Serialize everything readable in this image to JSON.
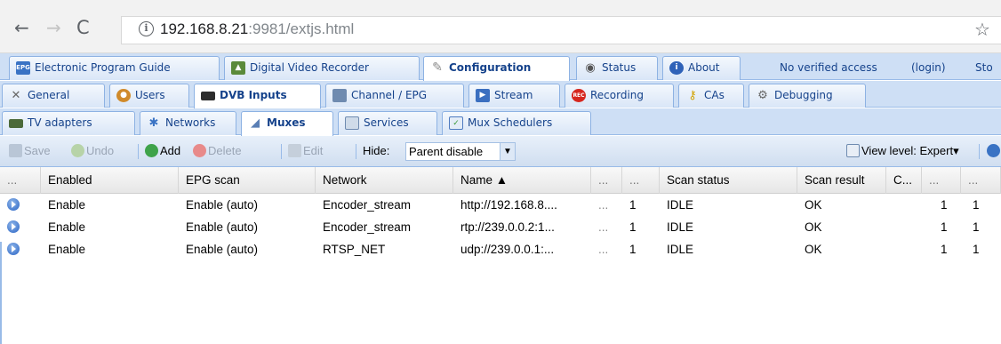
{
  "browser": {
    "url_host": "192.168.8.21",
    "url_rest": ":9981/extjs.html",
    "back": "←",
    "forward": "→",
    "reload": "C",
    "info": "i",
    "star": "☆"
  },
  "top_tabs": {
    "items": [
      {
        "label": "Electronic Program Guide",
        "icon": "epg-icon"
      },
      {
        "label": "Digital Video Recorder",
        "icon": "dvr-icon"
      },
      {
        "label": "Configuration",
        "icon": "wrench-icon",
        "active": true
      },
      {
        "label": "Status",
        "icon": "eye-icon"
      },
      {
        "label": "About",
        "icon": "info-icon"
      }
    ],
    "access_text": "No verified access",
    "login_text": "(login)",
    "trailing_text": "Sto"
  },
  "config_tabs": {
    "items": [
      {
        "label": "General",
        "icon": "tools-icon"
      },
      {
        "label": "Users",
        "icon": "users-icon"
      },
      {
        "label": "DVB Inputs",
        "icon": "card-icon",
        "active": true
      },
      {
        "label": "Channel / EPG",
        "icon": "tv-icon"
      },
      {
        "label": "Stream",
        "icon": "stream-icon"
      },
      {
        "label": "Recording",
        "icon": "rec-icon"
      },
      {
        "label": "CAs",
        "icon": "key-icon"
      },
      {
        "label": "Debugging",
        "icon": "gears-icon"
      }
    ]
  },
  "dvb_tabs": {
    "items": [
      {
        "label": "TV adapters",
        "icon": "adapter-icon"
      },
      {
        "label": "Networks",
        "icon": "antenna-icon"
      },
      {
        "label": "Muxes",
        "icon": "dish-icon",
        "active": true
      },
      {
        "label": "Services",
        "icon": "services-icon"
      },
      {
        "label": "Mux Schedulers",
        "icon": "calendar-icon"
      }
    ]
  },
  "toolbar": {
    "save": "Save",
    "undo": "Undo",
    "add": "Add",
    "delete": "Delete",
    "edit": "Edit",
    "hide_label": "Hide:",
    "hide_value": "Parent disable",
    "view_level": "View level: Expert",
    "view_level_arrow": "▾"
  },
  "grid": {
    "columns": [
      "...",
      "Enabled",
      "EPG scan",
      "Network",
      "Name ▲",
      "...",
      "...",
      "Scan status",
      "Scan result",
      "C...",
      "...",
      "..."
    ],
    "rows": [
      [
        "Enable",
        "Enable (auto)",
        "Encoder_stream",
        "http://192.168.8....",
        "...",
        "1",
        "IDLE",
        "OK",
        "",
        "1",
        "1"
      ],
      [
        "Enable",
        "Enable (auto)",
        "Encoder_stream",
        "rtp://239.0.0.2:1...",
        "...",
        "1",
        "IDLE",
        "OK",
        "",
        "1",
        "1"
      ],
      [
        "Enable",
        "Enable (auto)",
        "RTSP_NET",
        "udp://239.0.0.1:...",
        "...",
        "1",
        "IDLE",
        "OK",
        "",
        "1",
        "1"
      ]
    ]
  },
  "colors": {
    "tab_text": "#15428b",
    "tabstrip_bg": "#cedff5",
    "border": "#99bbe8"
  }
}
